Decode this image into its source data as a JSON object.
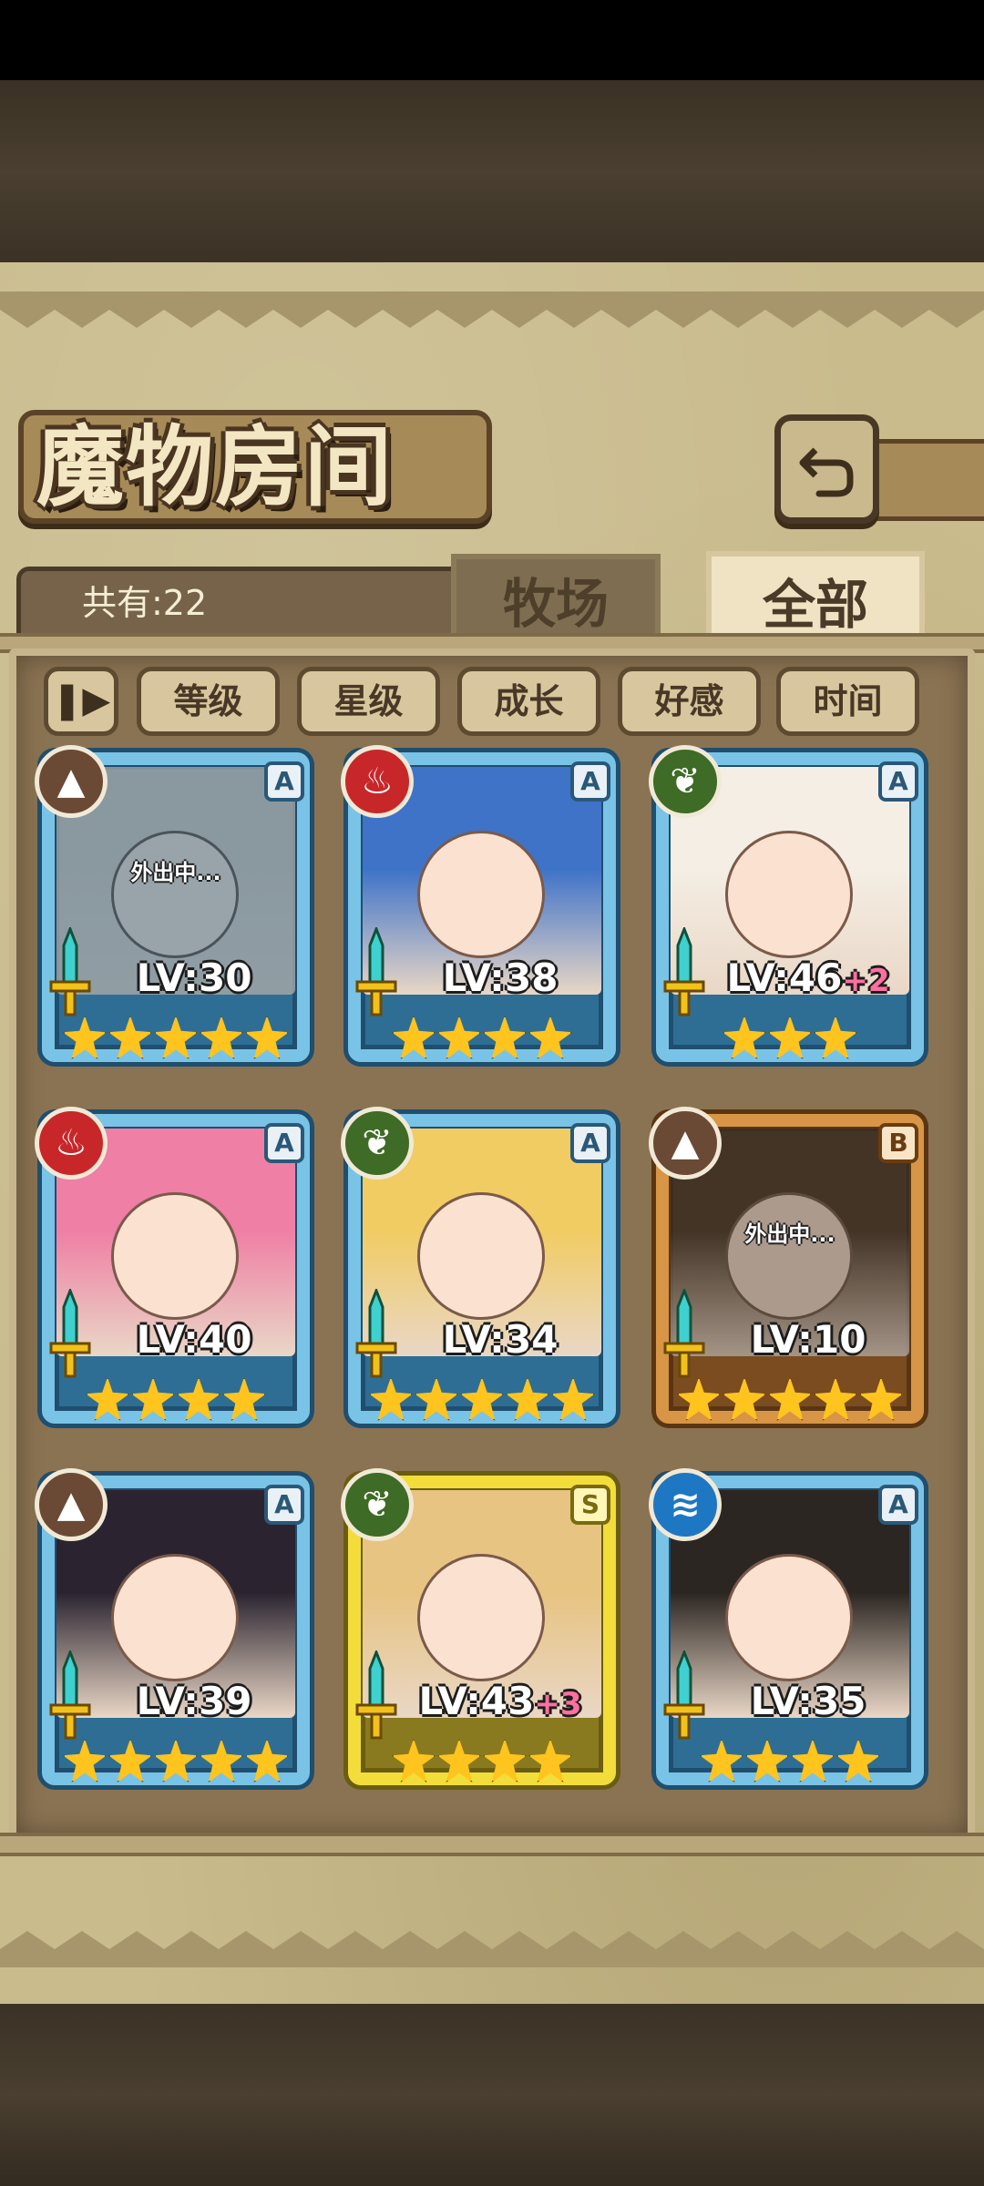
{
  "title": "魔物房间",
  "count_label": "共有:22",
  "tabs": {
    "ranch": "牧场",
    "all": "全部"
  },
  "sort": {
    "toggle_icon": "pause-sort-icon",
    "buttons": [
      "等级",
      "星级",
      "成长",
      "好感",
      "时间"
    ]
  },
  "busy_text": "外出中...",
  "colors": {
    "fire": "#c8272a",
    "leaf": "#3e6b25",
    "earth": "#6b4a35",
    "water": "#1e77c2",
    "frame_blue": "#79c3e6",
    "frame_gold": "#d89545",
    "frame_yellow": "#f3dd3a"
  },
  "cards": [
    {
      "element": "earth",
      "rank": "A",
      "level": "LV:30",
      "bonus": "",
      "stars": 5,
      "busy": true,
      "frame": "blue",
      "hair": "#d7d2c4"
    },
    {
      "element": "fire",
      "rank": "A",
      "level": "LV:38",
      "bonus": "",
      "stars": 4,
      "busy": false,
      "frame": "blue",
      "hair": "#3f73c8"
    },
    {
      "element": "leaf",
      "rank": "A",
      "level": "LV:46",
      "bonus": "+2",
      "stars": 3,
      "busy": false,
      "frame": "blue",
      "hair": "#f4eee4"
    },
    {
      "element": "fire",
      "rank": "A",
      "level": "LV:40",
      "bonus": "",
      "stars": 4,
      "busy": false,
      "frame": "blue",
      "hair": "#ef7fa5"
    },
    {
      "element": "leaf",
      "rank": "A",
      "level": "LV:34",
      "bonus": "",
      "stars": 5,
      "busy": false,
      "frame": "blue",
      "hair": "#f1cc63"
    },
    {
      "element": "earth",
      "rank": "B",
      "level": "LV:10",
      "bonus": "",
      "stars": 5,
      "busy": true,
      "frame": "gold",
      "hair": "#4a3528"
    },
    {
      "element": "earth",
      "rank": "A",
      "level": "LV:39",
      "bonus": "",
      "stars": 5,
      "busy": false,
      "frame": "blue",
      "hair": "#2b2430"
    },
    {
      "element": "leaf",
      "rank": "S",
      "level": "LV:43",
      "bonus": "+3",
      "stars": 4,
      "busy": false,
      "frame": "yellow",
      "hair": "#e8c482"
    },
    {
      "element": "water",
      "rank": "A",
      "level": "LV:35",
      "bonus": "",
      "stars": 4,
      "busy": false,
      "frame": "blue",
      "hair": "#2c2622"
    }
  ]
}
